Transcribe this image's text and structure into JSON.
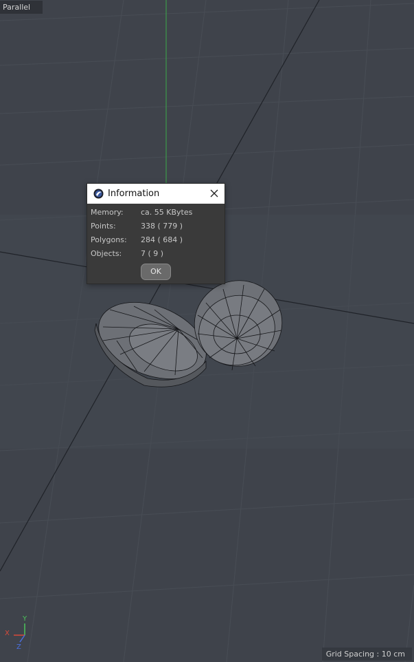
{
  "viewport": {
    "view_mode": "Parallel",
    "grid_spacing": "Grid Spacing : 10 cm",
    "colors": {
      "background": "#3f434b",
      "grid_line": "#4b5058",
      "axis_line": "#20232a",
      "y_axis": "#3c9a4a"
    },
    "axis_gizmo": {
      "x_label": "X",
      "y_label": "Y",
      "z_label": "Z"
    }
  },
  "dialog": {
    "title": "Information",
    "icon": "cinema4d-logo-icon",
    "close_icon": "close-icon",
    "rows": [
      {
        "label": "Memory:",
        "value": "ca. 55 KBytes"
      },
      {
        "label": "Points:",
        "value": "338 ( 779 )"
      },
      {
        "label": "Polygons:",
        "value": "284 ( 684 )"
      },
      {
        "label": "Objects:",
        "value": "7 ( 9 )"
      }
    ],
    "ok_label": "OK"
  }
}
